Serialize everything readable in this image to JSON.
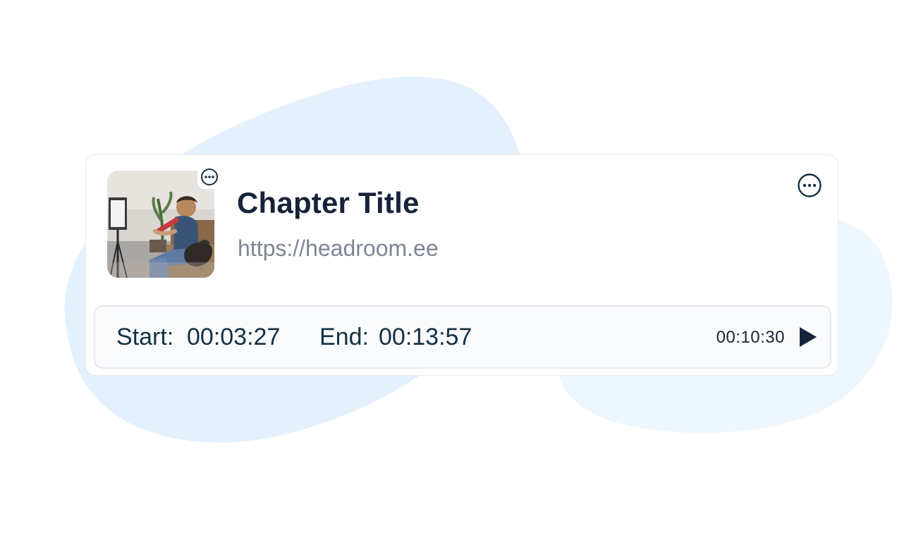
{
  "chapter": {
    "title": "Chapter Title",
    "url": "https://headroom.ee"
  },
  "timing": {
    "start_label": "Start:",
    "start_value": "00:03:27",
    "end_label": "End:",
    "end_value": "00:13:57",
    "duration": "00:10:30"
  },
  "icons": {
    "thumbnail_menu": "more-horizontal-circle-icon",
    "card_menu": "more-horizontal-circle-icon",
    "play": "play-icon"
  },
  "colors": {
    "title": "#17233a",
    "url": "#7e8694",
    "time_text": "#143043",
    "blob_primary": "#e3f0fd",
    "blob_secondary": "#eef6fe"
  }
}
